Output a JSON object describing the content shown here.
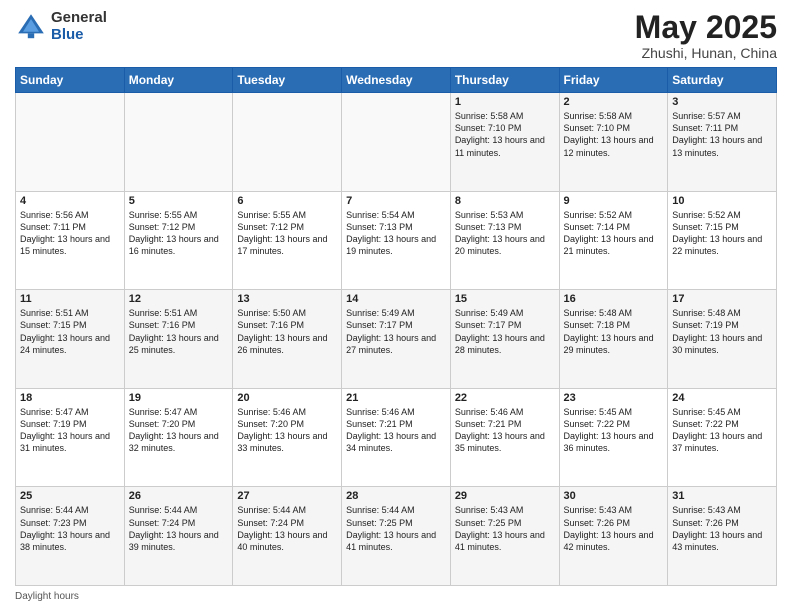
{
  "header": {
    "logo_general": "General",
    "logo_blue": "Blue",
    "month_title": "May 2025",
    "location": "Zhushi, Hunan, China"
  },
  "weekdays": [
    "Sunday",
    "Monday",
    "Tuesday",
    "Wednesday",
    "Thursday",
    "Friday",
    "Saturday"
  ],
  "weeks": [
    [
      {
        "day": "",
        "info": ""
      },
      {
        "day": "",
        "info": ""
      },
      {
        "day": "",
        "info": ""
      },
      {
        "day": "",
        "info": ""
      },
      {
        "day": "1",
        "info": "Sunrise: 5:58 AM\nSunset: 7:10 PM\nDaylight: 13 hours and 11 minutes."
      },
      {
        "day": "2",
        "info": "Sunrise: 5:58 AM\nSunset: 7:10 PM\nDaylight: 13 hours and 12 minutes."
      },
      {
        "day": "3",
        "info": "Sunrise: 5:57 AM\nSunset: 7:11 PM\nDaylight: 13 hours and 13 minutes."
      }
    ],
    [
      {
        "day": "4",
        "info": "Sunrise: 5:56 AM\nSunset: 7:11 PM\nDaylight: 13 hours and 15 minutes."
      },
      {
        "day": "5",
        "info": "Sunrise: 5:55 AM\nSunset: 7:12 PM\nDaylight: 13 hours and 16 minutes."
      },
      {
        "day": "6",
        "info": "Sunrise: 5:55 AM\nSunset: 7:12 PM\nDaylight: 13 hours and 17 minutes."
      },
      {
        "day": "7",
        "info": "Sunrise: 5:54 AM\nSunset: 7:13 PM\nDaylight: 13 hours and 19 minutes."
      },
      {
        "day": "8",
        "info": "Sunrise: 5:53 AM\nSunset: 7:13 PM\nDaylight: 13 hours and 20 minutes."
      },
      {
        "day": "9",
        "info": "Sunrise: 5:52 AM\nSunset: 7:14 PM\nDaylight: 13 hours and 21 minutes."
      },
      {
        "day": "10",
        "info": "Sunrise: 5:52 AM\nSunset: 7:15 PM\nDaylight: 13 hours and 22 minutes."
      }
    ],
    [
      {
        "day": "11",
        "info": "Sunrise: 5:51 AM\nSunset: 7:15 PM\nDaylight: 13 hours and 24 minutes."
      },
      {
        "day": "12",
        "info": "Sunrise: 5:51 AM\nSunset: 7:16 PM\nDaylight: 13 hours and 25 minutes."
      },
      {
        "day": "13",
        "info": "Sunrise: 5:50 AM\nSunset: 7:16 PM\nDaylight: 13 hours and 26 minutes."
      },
      {
        "day": "14",
        "info": "Sunrise: 5:49 AM\nSunset: 7:17 PM\nDaylight: 13 hours and 27 minutes."
      },
      {
        "day": "15",
        "info": "Sunrise: 5:49 AM\nSunset: 7:17 PM\nDaylight: 13 hours and 28 minutes."
      },
      {
        "day": "16",
        "info": "Sunrise: 5:48 AM\nSunset: 7:18 PM\nDaylight: 13 hours and 29 minutes."
      },
      {
        "day": "17",
        "info": "Sunrise: 5:48 AM\nSunset: 7:19 PM\nDaylight: 13 hours and 30 minutes."
      }
    ],
    [
      {
        "day": "18",
        "info": "Sunrise: 5:47 AM\nSunset: 7:19 PM\nDaylight: 13 hours and 31 minutes."
      },
      {
        "day": "19",
        "info": "Sunrise: 5:47 AM\nSunset: 7:20 PM\nDaylight: 13 hours and 32 minutes."
      },
      {
        "day": "20",
        "info": "Sunrise: 5:46 AM\nSunset: 7:20 PM\nDaylight: 13 hours and 33 minutes."
      },
      {
        "day": "21",
        "info": "Sunrise: 5:46 AM\nSunset: 7:21 PM\nDaylight: 13 hours and 34 minutes."
      },
      {
        "day": "22",
        "info": "Sunrise: 5:46 AM\nSunset: 7:21 PM\nDaylight: 13 hours and 35 minutes."
      },
      {
        "day": "23",
        "info": "Sunrise: 5:45 AM\nSunset: 7:22 PM\nDaylight: 13 hours and 36 minutes."
      },
      {
        "day": "24",
        "info": "Sunrise: 5:45 AM\nSunset: 7:22 PM\nDaylight: 13 hours and 37 minutes."
      }
    ],
    [
      {
        "day": "25",
        "info": "Sunrise: 5:44 AM\nSunset: 7:23 PM\nDaylight: 13 hours and 38 minutes."
      },
      {
        "day": "26",
        "info": "Sunrise: 5:44 AM\nSunset: 7:24 PM\nDaylight: 13 hours and 39 minutes."
      },
      {
        "day": "27",
        "info": "Sunrise: 5:44 AM\nSunset: 7:24 PM\nDaylight: 13 hours and 40 minutes."
      },
      {
        "day": "28",
        "info": "Sunrise: 5:44 AM\nSunset: 7:25 PM\nDaylight: 13 hours and 41 minutes."
      },
      {
        "day": "29",
        "info": "Sunrise: 5:43 AM\nSunset: 7:25 PM\nDaylight: 13 hours and 41 minutes."
      },
      {
        "day": "30",
        "info": "Sunrise: 5:43 AM\nSunset: 7:26 PM\nDaylight: 13 hours and 42 minutes."
      },
      {
        "day": "31",
        "info": "Sunrise: 5:43 AM\nSunset: 7:26 PM\nDaylight: 13 hours and 43 minutes."
      }
    ]
  ],
  "footer": {
    "daylight_label": "Daylight hours"
  }
}
